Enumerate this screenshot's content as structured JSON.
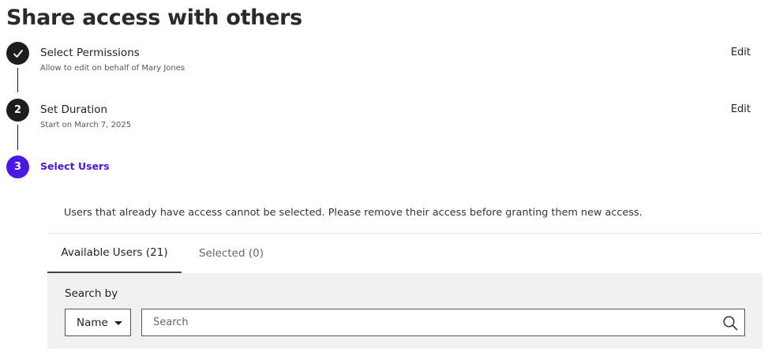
{
  "page": {
    "title": "Share access with others"
  },
  "steps": [
    {
      "marker": "check",
      "title": "Select Permissions",
      "subtitle": "Allow to edit on behalf of Mary Jones",
      "edit_label": "Edit",
      "status": "completed"
    },
    {
      "marker": "2",
      "title": "Set Duration",
      "subtitle": "Start on March 7, 2025",
      "edit_label": "Edit",
      "status": "completed"
    },
    {
      "marker": "3",
      "title": "Select Users",
      "status": "active"
    }
  ],
  "notice": "Users that already have access cannot be selected. Please remove their access before granting them new access.",
  "tabs": [
    {
      "label": "Available Users (21)",
      "active": true
    },
    {
      "label": "Selected (0)",
      "active": false
    }
  ],
  "search": {
    "label": "Search by",
    "field_selected": "Name",
    "placeholder": "Search",
    "value": ""
  },
  "colors": {
    "active_step": "#4a17e8",
    "completed_step": "#1d1d1d",
    "panel_background": "#f1f1f1"
  },
  "icons": {
    "step1": "checkmark-icon",
    "select": "caret-down-icon",
    "search": "search-icon"
  }
}
